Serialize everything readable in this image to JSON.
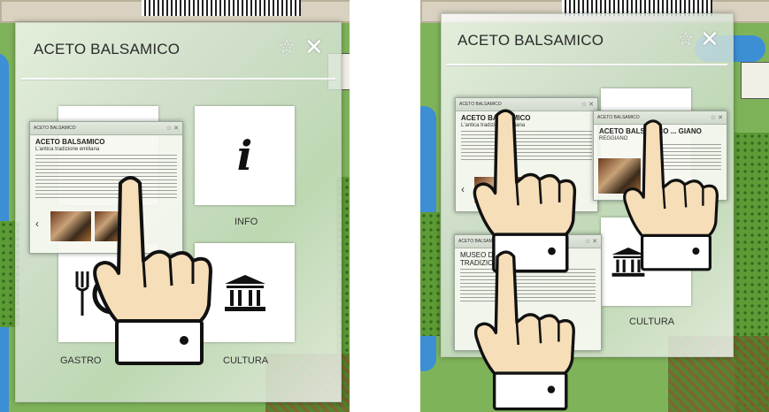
{
  "screens": [
    {
      "panel": {
        "title": "ACETO BALSAMICO",
        "star_icon": "star-outline-icon",
        "close_icon": "close-icon",
        "tiles": [
          {
            "id": "info",
            "label": "INFO",
            "icon": "info-icon"
          },
          {
            "id": "gastronomia",
            "label": "GASTRO",
            "icon": "fork-plate-icon"
          },
          {
            "id": "cultura",
            "label": "CULTURA",
            "icon": "museum-icon"
          }
        ]
      },
      "mini_card": {
        "bar_title": "ACETO BALSAMICO",
        "title": "ACETO BALSAMICO",
        "subtitle": "L'antica tradizione emiliana"
      }
    },
    {
      "panel": {
        "title": "ACETO BALSAMICO",
        "star_icon": "star-outline-icon",
        "close_icon": "close-icon",
        "tiles": [
          {
            "id": "cultura",
            "label": "CULTURA",
            "icon": "museum-icon"
          }
        ]
      },
      "mini_cards": [
        {
          "bar_title": "ACETO BALSAMICO",
          "title": "ACETO BALSAMICO",
          "subtitle": "L'antica tradizione emiliana"
        },
        {
          "bar_title": "ACETO BALSAMICO",
          "title": "ACETO BALSAMICO ... GIANO",
          "subtitle": "REGGIANO"
        },
        {
          "bar_title": "ACETO BALSAMICO",
          "title": "MUSEO D... ETO BALSAMICO TRADIZIO... MODENA",
          "subtitle": ""
        }
      ]
    }
  ],
  "colors": {
    "map_grass": "#7fb35a",
    "river": "#3c8fd4",
    "panel_bg": "#e4ebe3",
    "hand_skin": "#f5deb8",
    "cuff": "#ffffff"
  }
}
